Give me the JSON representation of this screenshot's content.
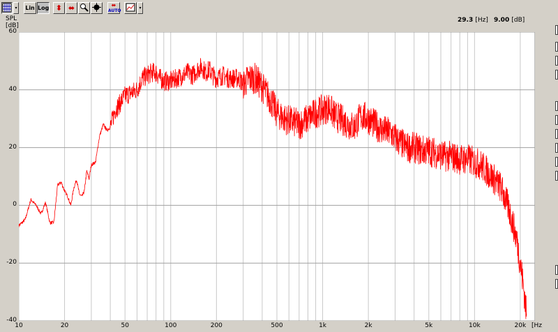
{
  "toolbar": {
    "buttons": [
      {
        "name": "grid-icon",
        "label": ""
      },
      {
        "name": "lin-button",
        "label": "Lin"
      },
      {
        "name": "log-button",
        "label": "Log"
      },
      {
        "name": "vertical-zoom-icon",
        "label": ""
      },
      {
        "name": "horizontal-zoom-icon",
        "label": ""
      },
      {
        "name": "magnifier-icon",
        "label": ""
      },
      {
        "name": "cursor-icon",
        "label": ""
      },
      {
        "name": "auto-button",
        "label": "AUTO"
      },
      {
        "name": "graph-options-icon",
        "label": ""
      }
    ]
  },
  "readout": {
    "frequency": "29.3",
    "frequency_unit": "[Hz]",
    "level": "9.00",
    "level_unit": "[dB]"
  },
  "y_axis": {
    "label_line1": "SPL",
    "label_line2": "[dB]"
  },
  "x_axis": {
    "unit": "[Hz]"
  },
  "colors": {
    "curve": "#ff0000",
    "background": "#ffffff",
    "grid": "#c8c8c8",
    "panel": "#d4d0c8"
  },
  "chart_data": {
    "type": "line",
    "title": "",
    "xlabel": "[Hz]",
    "ylabel": "SPL [dB]",
    "x_scale": "log",
    "xlim": [
      10,
      25000
    ],
    "ylim": [
      -40,
      60
    ],
    "y_ticks": [
      "60",
      "40",
      "20",
      "0",
      "-20",
      "-40"
    ],
    "x_ticks": [
      {
        "value": 10,
        "label": "10"
      },
      {
        "value": 20,
        "label": "20"
      },
      {
        "value": 50,
        "label": "50"
      },
      {
        "value": 100,
        "label": "100"
      },
      {
        "value": 200,
        "label": "200"
      },
      {
        "value": 500,
        "label": "500"
      },
      {
        "value": 1000,
        "label": "1k"
      },
      {
        "value": 2000,
        "label": "2k"
      },
      {
        "value": 5000,
        "label": "5k"
      },
      {
        "value": 10000,
        "label": "10k"
      },
      {
        "value": 20000,
        "label": "20k"
      }
    ],
    "grid": true,
    "series": [
      {
        "color": "#ff0000",
        "x": [
          10,
          11,
          12,
          13,
          14,
          15,
          16,
          17,
          18,
          19,
          20,
          21,
          22,
          23,
          24,
          25,
          26,
          27,
          28,
          29,
          30,
          32,
          34,
          36,
          38,
          40,
          43,
          46,
          50,
          55,
          60,
          65,
          70,
          75,
          80,
          85,
          90,
          100,
          110,
          120,
          130,
          140,
          150,
          160,
          170,
          180,
          190,
          200,
          220,
          240,
          260,
          280,
          300,
          330,
          360,
          400,
          450,
          500,
          560,
          630,
          700,
          800,
          900,
          1000,
          1100,
          1200,
          1400,
          1600,
          1800,
          2000,
          2200,
          2500,
          2800,
          3200,
          3600,
          4000,
          4500,
          5000,
          5600,
          6300,
          7000,
          8000,
          9000,
          10000,
          11000,
          12000,
          13000,
          14000,
          15000,
          16000,
          17000,
          18000,
          19000,
          20000,
          21000,
          22000
        ],
        "y": [
          -7,
          -5,
          2,
          0,
          -3,
          1,
          -6,
          -6,
          7,
          8,
          5,
          3,
          0,
          6,
          9,
          4,
          3,
          5,
          12,
          9,
          14,
          15,
          24,
          28,
          26,
          27,
          33,
          35,
          38,
          39,
          40,
          44,
          45,
          46,
          46,
          44,
          43,
          43,
          44,
          45,
          46,
          45,
          47,
          48,
          46,
          47,
          45,
          44,
          45,
          44,
          44,
          44,
          42,
          44,
          44,
          41,
          37,
          32,
          30,
          29,
          28,
          30,
          32,
          33,
          34,
          31,
          29,
          27,
          31,
          30,
          28,
          26,
          25,
          22,
          20,
          20,
          19,
          19,
          18,
          17,
          17,
          16,
          16,
          15,
          14,
          12,
          10,
          8,
          6,
          2,
          -2,
          -7,
          -12,
          -20,
          -28,
          -38
        ]
      }
    ]
  }
}
